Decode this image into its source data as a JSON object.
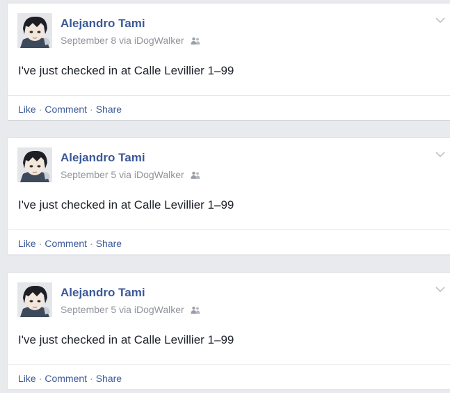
{
  "posts": [
    {
      "author": "Alejandro Tami",
      "date": "September 8",
      "via_prefix": "via",
      "app": "iDogWalker",
      "message": "I've just checked in at Calle Levillier 1–99",
      "audience_icon": "friends-icon",
      "actions": {
        "like": "Like",
        "comment": "Comment",
        "share": "Share",
        "separator": "·"
      }
    },
    {
      "author": "Alejandro Tami",
      "date": "September 5",
      "via_prefix": "via",
      "app": "iDogWalker",
      "message": "I've just checked in at Calle Levillier 1–99",
      "audience_icon": "friends-icon",
      "actions": {
        "like": "Like",
        "comment": "Comment",
        "share": "Share",
        "separator": "·"
      }
    },
    {
      "author": "Alejandro Tami",
      "date": "September 5",
      "via_prefix": "via",
      "app": "iDogWalker",
      "message": "I've just checked in at Calle Levillier 1–99",
      "audience_icon": "friends-icon",
      "actions": {
        "like": "Like",
        "comment": "Comment",
        "share": "Share",
        "separator": "·"
      }
    }
  ],
  "colors": {
    "background": "#e9eaed",
    "link": "#3b5998",
    "meta": "#90949c",
    "text": "#1d2129"
  }
}
